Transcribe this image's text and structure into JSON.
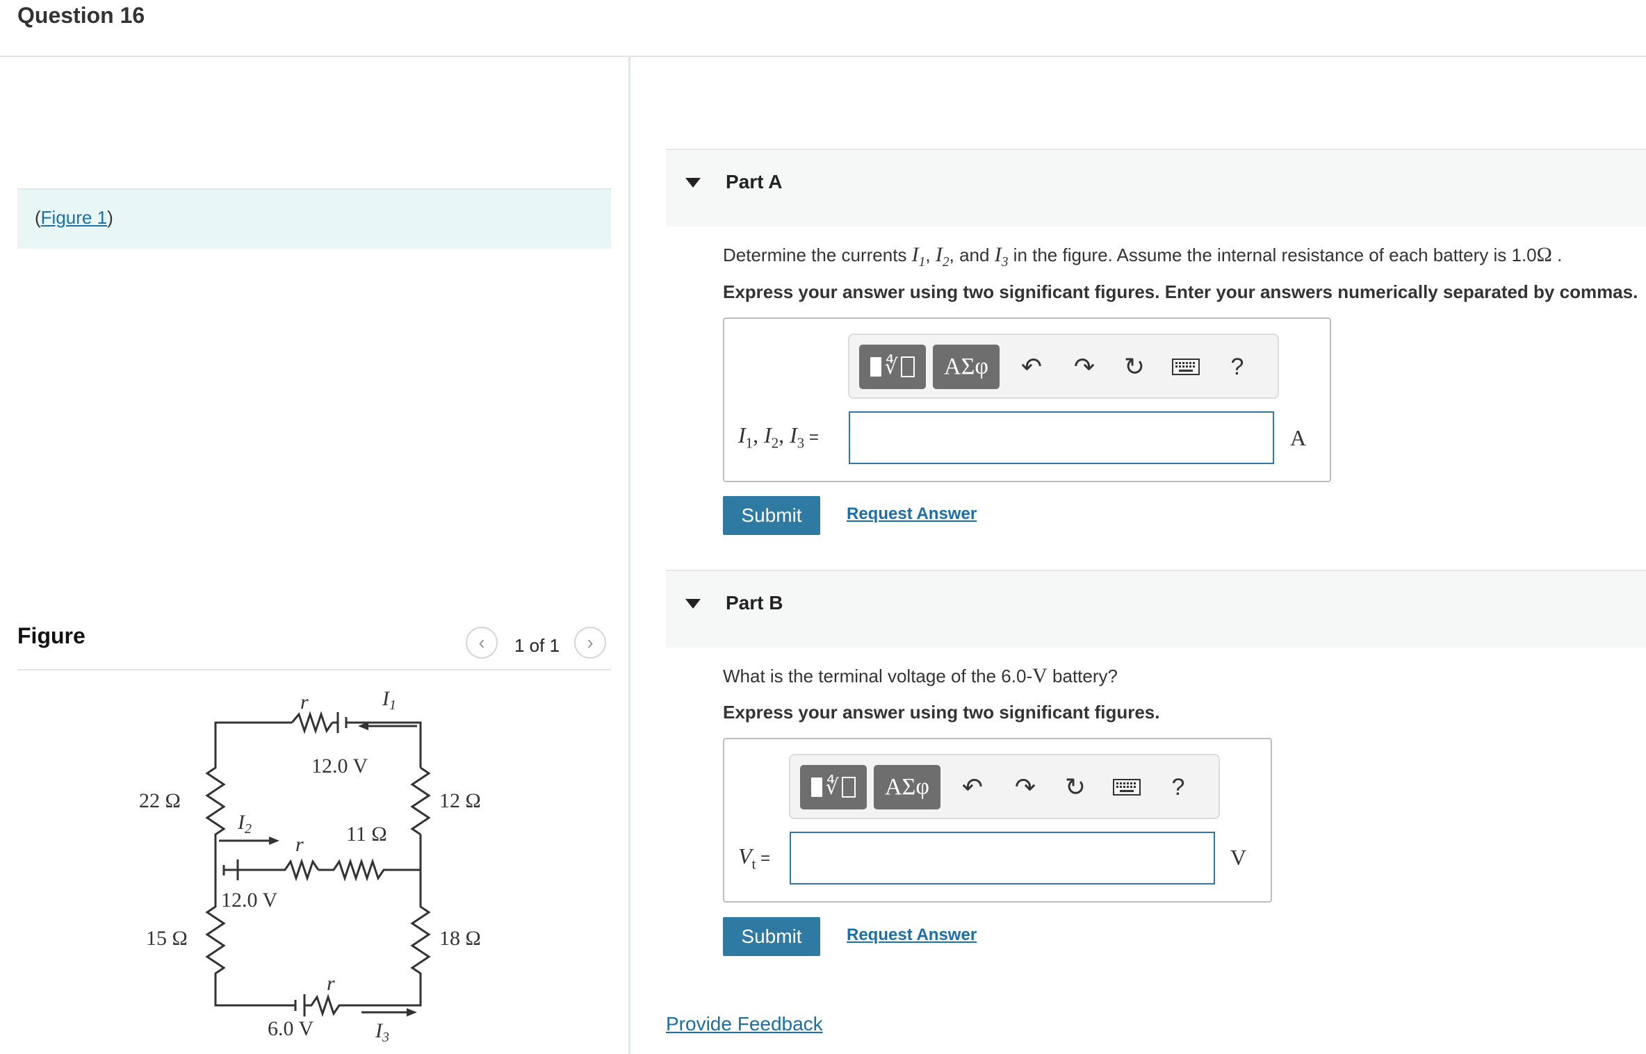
{
  "question": {
    "title": "Question 16"
  },
  "figure_link": {
    "open": "(",
    "label": "Figure 1",
    "close": ")"
  },
  "figure_panel": {
    "heading": "Figure",
    "pager_text": "1 of 1",
    "prev_icon": "chevron-left-icon",
    "next_icon": "chevron-right-icon"
  },
  "circuit": {
    "top_resistor_label": "r",
    "current_1": "I",
    "current_1_sub": "1",
    "top_battery": "12.0 V",
    "left_top_resistor": "22 Ω",
    "right_top_resistor": "12 Ω",
    "current_2": "I",
    "current_2_sub": "2",
    "mid_internal": "r",
    "mid_resistor": "11 Ω",
    "mid_battery": "12.0 V",
    "left_bottom_resistor": "15 Ω",
    "right_bottom_resistor": "18 Ω",
    "bottom_internal": "r",
    "bottom_battery": "6.0 V",
    "current_3": "I",
    "current_3_sub": "3"
  },
  "partA": {
    "label": "Part A",
    "prompt_pre": "Determine the currents ",
    "prompt_mid1": ", ",
    "prompt_mid2": ", and ",
    "prompt_post": " in the figure. Assume the internal resistance of each battery is 1.0",
    "ohm": "Ω",
    "prompt_end": " .",
    "var_I": "I",
    "sub1": "1",
    "sub2": "2",
    "sub3": "3",
    "instruction": "Express your answer using two significant figures. Enter your answers numerically separated by commas.",
    "answer_label_eq": " =",
    "answer_sep": ", ",
    "answer_value": "",
    "unit": "A",
    "submit": "Submit",
    "request": "Request Answer"
  },
  "partB": {
    "label": "Part B",
    "prompt_pre": "What is the terminal voltage of the 6.0-",
    "prompt_unit": "V",
    "prompt_post": " battery?",
    "instruction": "Express your answer using two significant figures.",
    "var": "V",
    "var_sub": "t",
    "answer_label_eq": " =",
    "answer_value": "",
    "unit": "V",
    "submit": "Submit",
    "request": "Request Answer"
  },
  "toolbar": {
    "templates_icon": "templates-icon",
    "symbols_label": "ΑΣφ",
    "undo_icon": "undo-icon",
    "redo_icon": "redo-icon",
    "reset_icon": "reset-icon",
    "keyboard_icon": "keyboard-icon",
    "help_label": "?"
  },
  "footer": {
    "feedback": "Provide Feedback"
  },
  "colors": {
    "accent": "#2f7aa3",
    "link": "#1a6fa8",
    "figure_box": "#e8f6f6"
  }
}
